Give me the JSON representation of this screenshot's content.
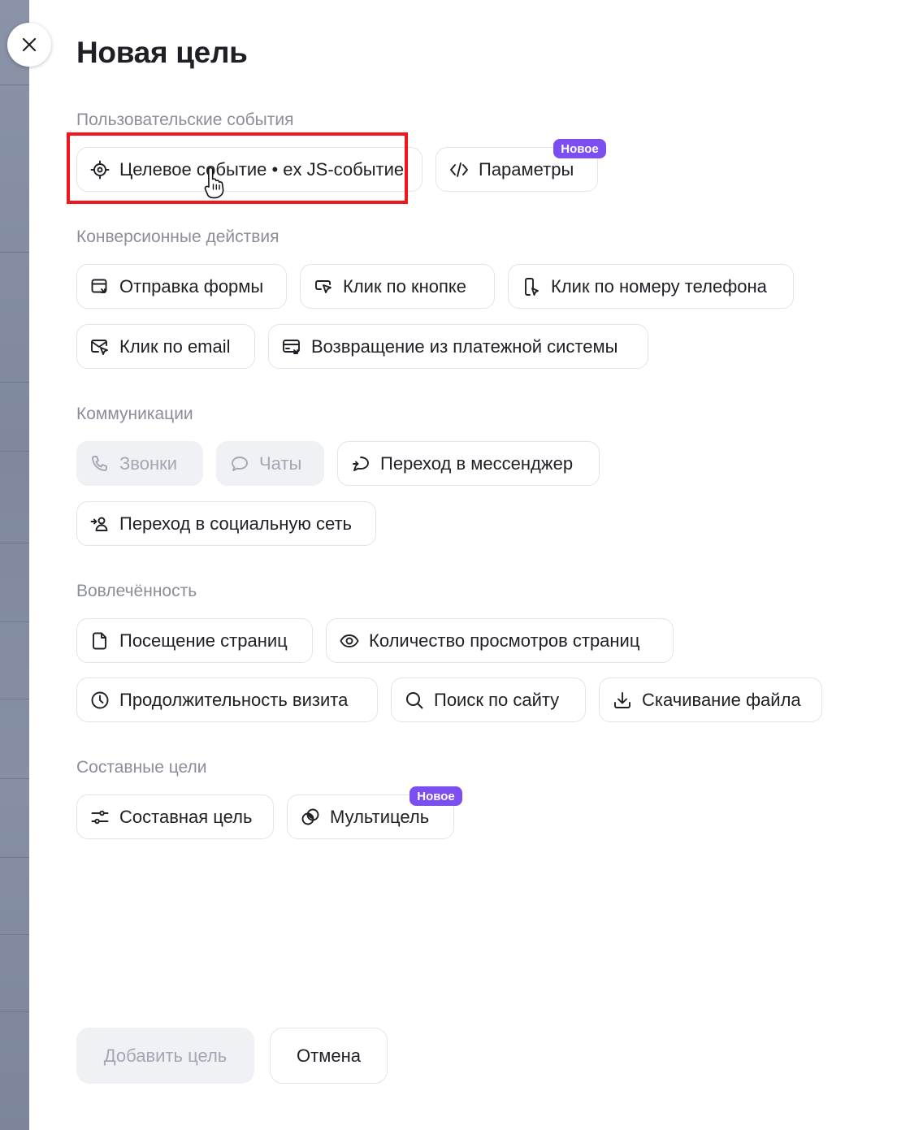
{
  "dialog": {
    "title": "Новая цель",
    "close_icon": "close-icon"
  },
  "sections": {
    "user_events": {
      "label": "Пользовательские события",
      "items": [
        {
          "label": "Целевое событие • ex JS-событие",
          "icon": "target-icon"
        },
        {
          "label": "Параметры",
          "icon": "code-icon",
          "badge": "Новое"
        }
      ]
    },
    "conversion": {
      "label": "Конверсионные действия",
      "items": [
        {
          "label": "Отправка формы",
          "icon": "form-submit-icon"
        },
        {
          "label": "Клик по кнопке",
          "icon": "button-click-icon"
        },
        {
          "label": "Клик по номеру телефона",
          "icon": "phone-click-icon"
        },
        {
          "label": "Клик по email",
          "icon": "email-click-icon"
        },
        {
          "label": "Возвращение из платежной системы",
          "icon": "payment-return-icon"
        }
      ]
    },
    "communications": {
      "label": "Коммуникации",
      "items": [
        {
          "label": "Звонки",
          "icon": "phone-icon",
          "disabled": true
        },
        {
          "label": "Чаты",
          "icon": "chat-icon",
          "disabled": true
        },
        {
          "label": "Переход в мессенджер",
          "icon": "messenger-icon"
        },
        {
          "label": "Переход в социальную сеть",
          "icon": "social-network-icon"
        }
      ]
    },
    "engagement": {
      "label": "Вовлечённость",
      "items": [
        {
          "label": "Посещение страниц",
          "icon": "page-icon"
        },
        {
          "label": "Количество просмотров страниц",
          "icon": "eye-icon"
        },
        {
          "label": "Продолжительность визита",
          "icon": "clock-icon"
        },
        {
          "label": "Поиск по сайту",
          "icon": "search-icon"
        },
        {
          "label": "Скачивание файла",
          "icon": "download-icon"
        }
      ]
    },
    "composite": {
      "label": "Составные цели",
      "items": [
        {
          "label": "Составная цель",
          "icon": "sliders-icon"
        },
        {
          "label": "Мультицель",
          "icon": "multigoal-icon",
          "badge": "Новое"
        }
      ]
    }
  },
  "footer": {
    "add_label": "Добавить цель",
    "cancel_label": "Отмена"
  },
  "colors": {
    "badge": "#7c4ef0",
    "highlight": "#f2151c",
    "disabled_bg": "#eff1f5"
  }
}
